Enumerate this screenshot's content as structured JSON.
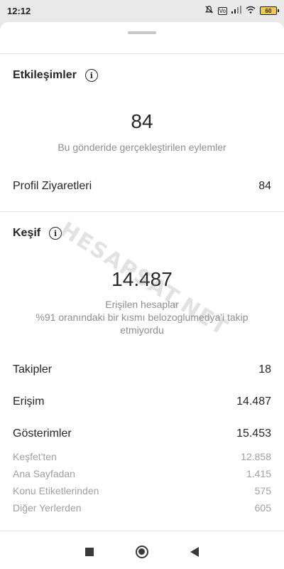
{
  "status_bar": {
    "time": "12:12",
    "vol_label": "Vo",
    "battery": "60"
  },
  "interactions": {
    "title": "Etkileşimler",
    "total": "84",
    "total_caption": "Bu gönderide gerçekleştirilen eylemler",
    "rows": [
      {
        "label": "Profil Ziyaretleri",
        "value": "84"
      }
    ]
  },
  "discovery": {
    "title": "Keşif",
    "reach_total": "14.487",
    "reach_caption_line1": "Erişilen hesaplar",
    "reach_caption_line2": "%91 oranındaki bir kısmı belozoglumedya'i takip",
    "reach_caption_line3": "etmiyordu",
    "rows": [
      {
        "label": "Takipler",
        "value": "18"
      },
      {
        "label": "Erişim",
        "value": "14.487"
      },
      {
        "label": "Gösterimler",
        "value": "15.453"
      }
    ],
    "sub_rows": [
      {
        "label": "Keşfet'ten",
        "value": "12.858"
      },
      {
        "label": "Ana Sayfadan",
        "value": "1.415"
      },
      {
        "label": "Konu Etiketlerinden",
        "value": "575"
      },
      {
        "label": "Diğer Yerlerden",
        "value": "605"
      }
    ]
  },
  "watermark": "HESAPSAT.NET"
}
